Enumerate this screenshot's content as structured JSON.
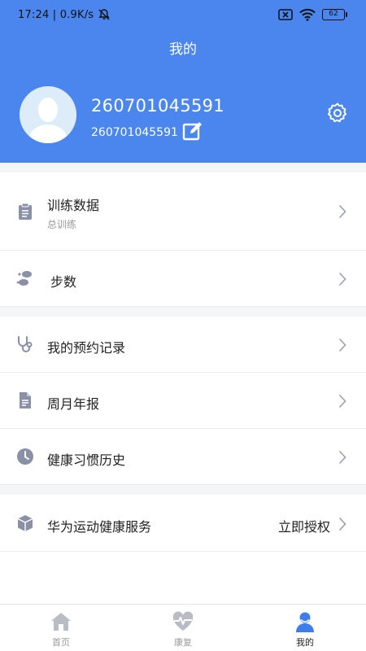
{
  "status_bar": {
    "time": "17:24 | 0.9K/s",
    "battery": "62"
  },
  "header": {
    "title": "我的"
  },
  "profile": {
    "name": "260701045591",
    "id": "260701045591"
  },
  "section1": [
    {
      "label": "训练数据",
      "subtitle": "总训练",
      "icon": "clipboard-icon"
    },
    {
      "label": "步数",
      "icon": "footprints-icon"
    }
  ],
  "section2": [
    {
      "label": "我的预约记录",
      "icon": "stethoscope-icon"
    },
    {
      "label": "周月年报",
      "icon": "document-icon"
    },
    {
      "label": "健康习惯历史",
      "icon": "clock-icon"
    }
  ],
  "section3": [
    {
      "label": "华为运动健康服务",
      "action": "立即授权",
      "icon": "cube-icon"
    }
  ],
  "tabbar": [
    {
      "label": "首页",
      "icon": "home-icon",
      "active": false
    },
    {
      "label": "康复",
      "icon": "heart-pulse-icon",
      "active": false
    },
    {
      "label": "我的",
      "icon": "user-icon",
      "active": true
    }
  ],
  "colors": {
    "primary": "#4a86ee",
    "icon_gray": "#8a90a6",
    "inactive": "#b9bcc4",
    "active_tab": "#3e7df0"
  }
}
